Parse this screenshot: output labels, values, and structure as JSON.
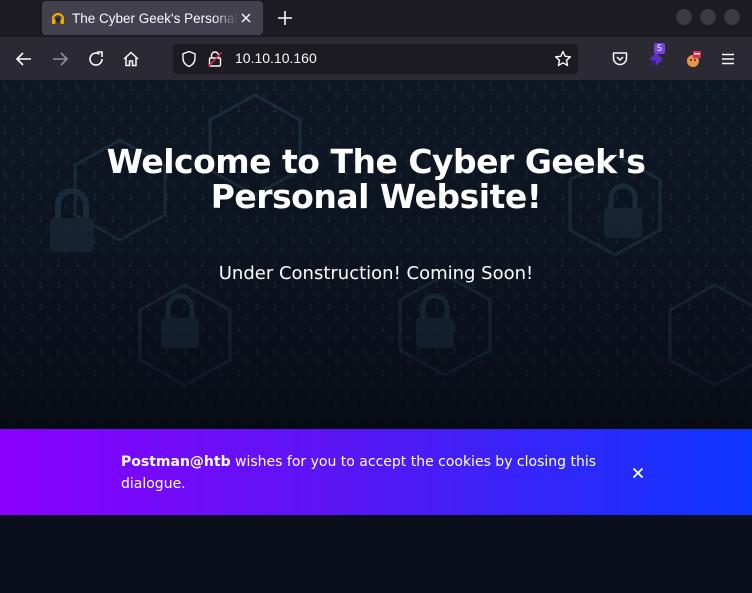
{
  "browser": {
    "tab": {
      "title": "The Cyber Geek's Personal Website",
      "favicon": "hacker-favicon-icon"
    },
    "url": "10.10.10.160",
    "extension_badge": "5",
    "icons": {
      "back": "arrow-left-icon",
      "forward": "arrow-right-icon",
      "reload": "reload-icon",
      "home": "home-icon",
      "shield": "shield-icon",
      "insecure": "lock-insecure-icon",
      "bookmark": "star-icon",
      "pocket": "pocket-icon",
      "menu": "hamburger-menu-icon"
    },
    "colors": {
      "tabbar": "#1c1b22",
      "navbar": "#2b2a33",
      "tab_active": "#42414d"
    }
  },
  "page": {
    "title": "Welcome to The Cyber Geek's Personal Website!",
    "subtitle": "Under Construction! Coming Soon!",
    "cookie_banner": {
      "brand": "Postman@htb",
      "message": " wishes for you to accept the cookies by closing this dialogue.",
      "gradient_start": "#8b00ff",
      "gradient_end": "#0d36ff"
    }
  }
}
